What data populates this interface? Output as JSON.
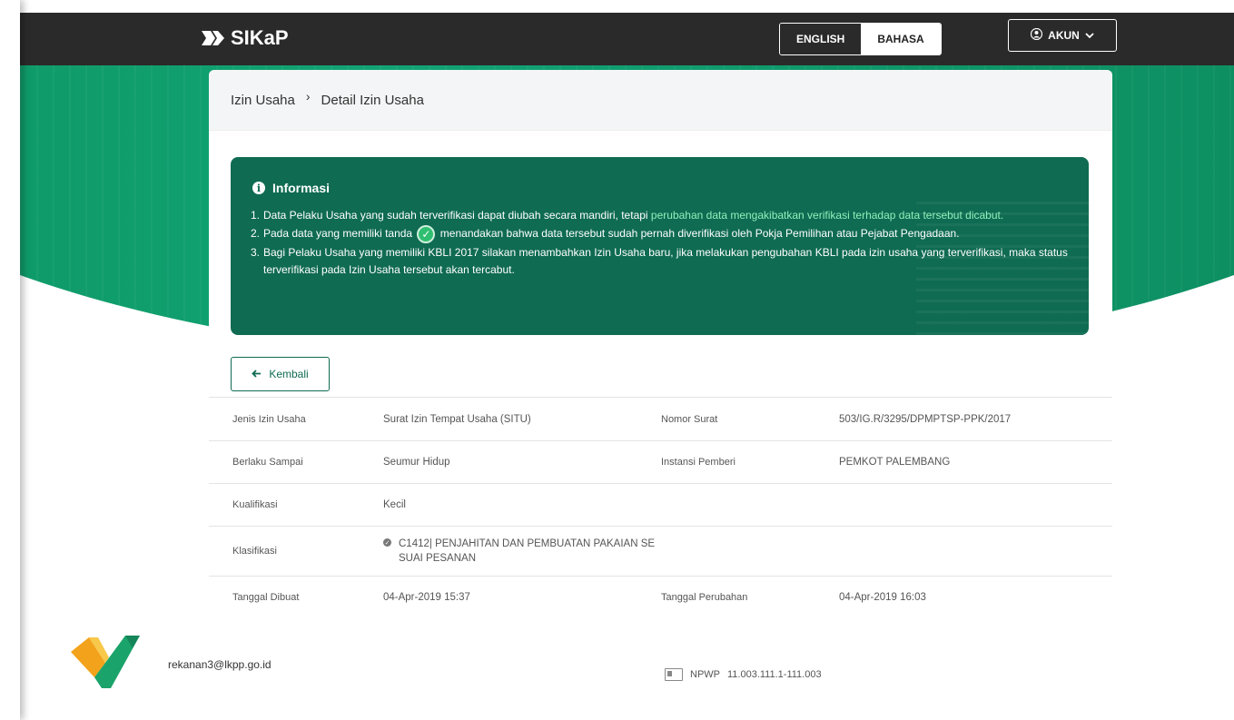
{
  "header": {
    "app_name": "SIKaP",
    "lang_english": "ENGLISH",
    "lang_bahasa": "BAHASA",
    "akun_label": "AKUN"
  },
  "breadcrumb": {
    "parent": "Izin Usaha",
    "current": "Detail Izin Usaha"
  },
  "info": {
    "title": "Informasi",
    "item1_num": "1.",
    "item1_text": "Data Pelaku Usaha yang sudah terverifikasi dapat diubah secara mandiri, tetapi ",
    "item1_highlight": "perubahan data mengakibatkan verifikasi terhadap data tersebut dicabut.",
    "item2_num": "2.",
    "item2_pre": "Pada data yang memiliki tanda",
    "item2_post": "menandakan bahwa data tersebut sudah pernah diverifikasi oleh Pokja Pemilihan atau Pejabat Pengadaan.",
    "item3_num": "3.",
    "item3_text": "Bagi Pelaku Usaha yang memiliki KBLI 2017 silakan menambahkan Izin Usaha baru, jika melakukan pengubahan KBLI pada izin usaha yang terverifikasi, maka status terverifikasi pada Izin Usaha tersebut akan tercabut."
  },
  "back_button": "Kembali",
  "details": {
    "jenis_label": "Jenis Izin Usaha",
    "jenis_value": "Surat Izin Tempat Usaha (SITU)",
    "nomor_label": "Nomor Surat",
    "nomor_value": "503/IG.R/3295/DPMPTSP-PPK/2017",
    "berlaku_label": "Berlaku Sampai",
    "berlaku_value": "Seumur Hidup",
    "instansi_label": "Instansi Pemberi",
    "instansi_value": "PEMKOT PALEMBANG",
    "kualifikasi_label": "Kualifikasi",
    "kualifikasi_value": "Kecil",
    "klasifikasi_label": "Klasifikasi",
    "klasifikasi_value": "C1412| PENJAHITAN DAN PEMBUATAN PAKAIAN SE SUAI PESANAN",
    "dibuat_label": "Tanggal Dibuat",
    "dibuat_value": "04-Apr-2019 15:37",
    "perubahan_label": "Tanggal Perubahan",
    "perubahan_value": "04-Apr-2019 16:03"
  },
  "footer": {
    "email": "rekanan3@lkpp.go.id",
    "npwp_label": "NPWP",
    "npwp_value": "11.003.111.1-111.003"
  }
}
